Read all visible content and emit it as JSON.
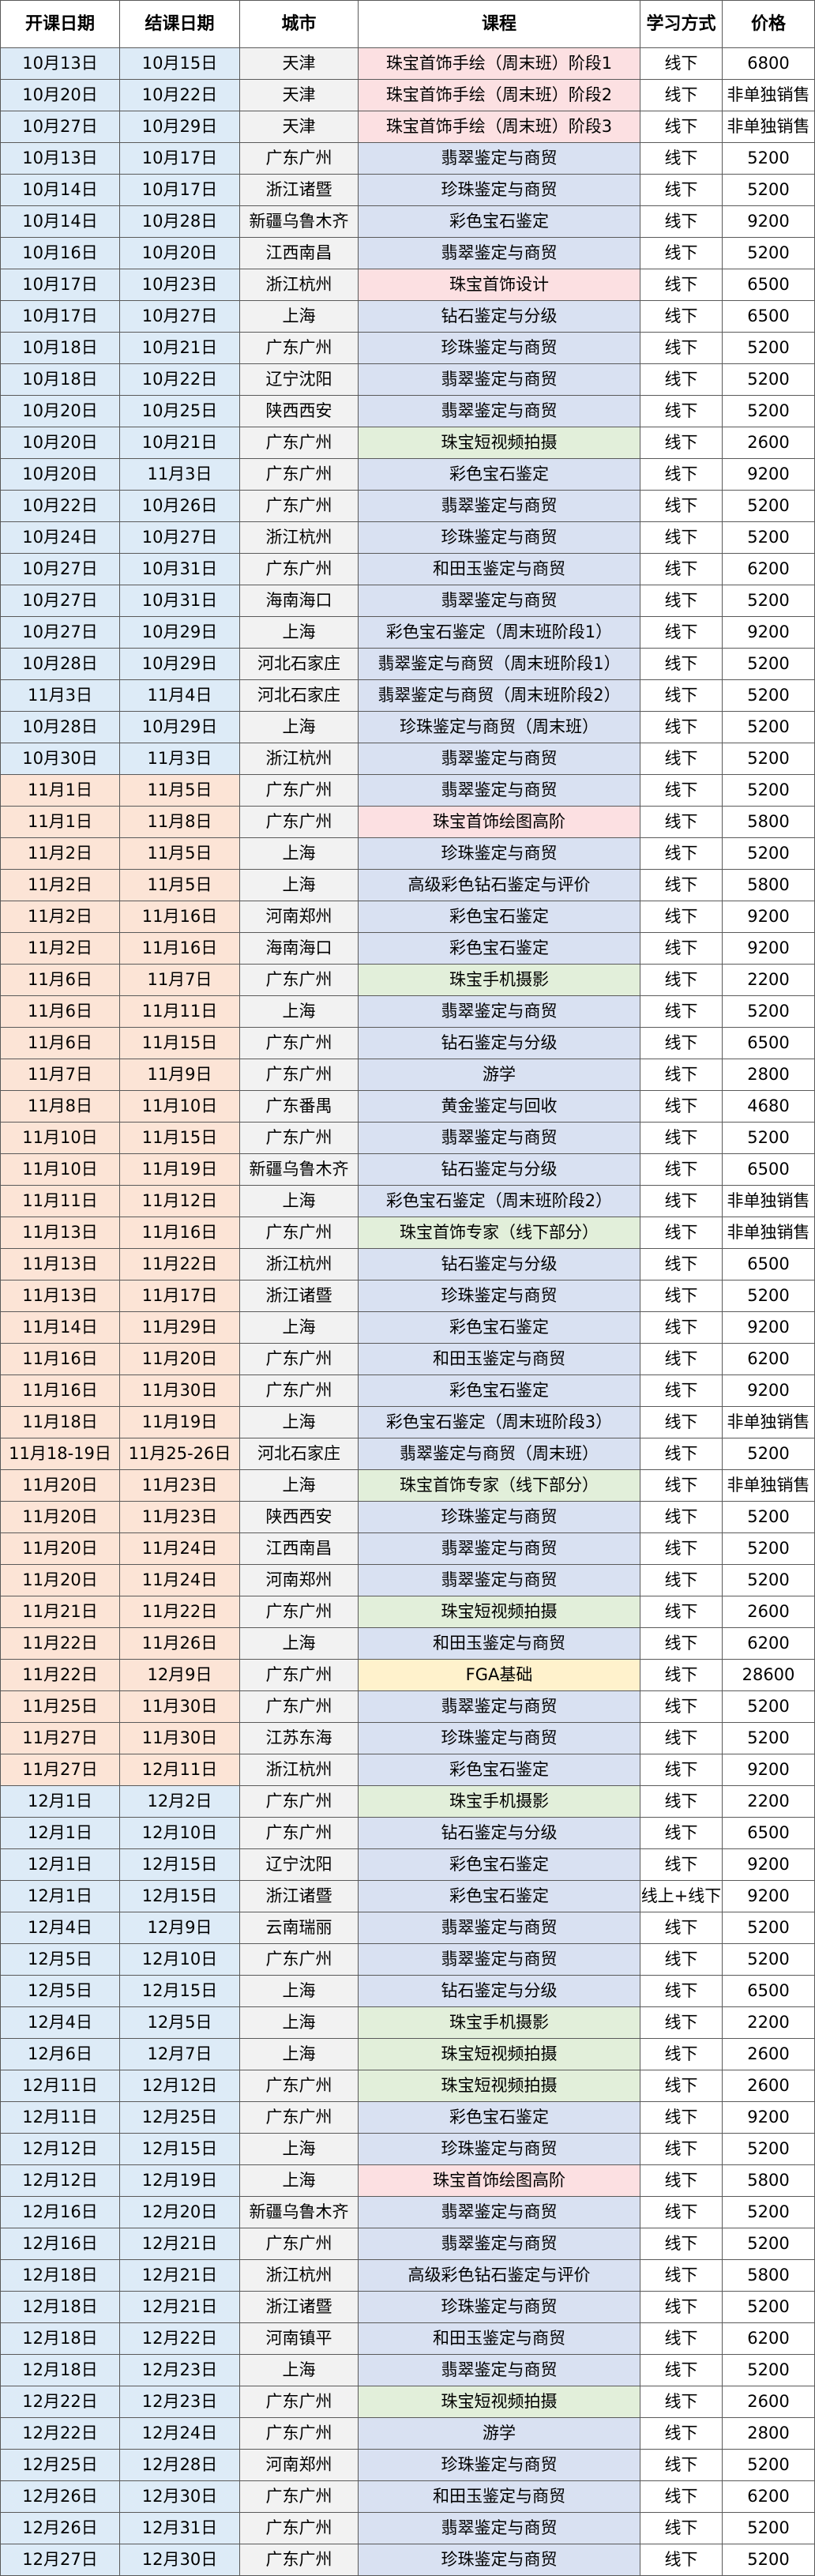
{
  "table": {
    "headers": [
      "开课日期",
      "结课日期",
      "城市",
      "课程",
      "学习方式",
      "价格"
    ],
    "rows": [
      {
        "start": "10月13日",
        "end": "10月15日",
        "city": "天津",
        "course": "珠宝首饰手绘（周末班）阶段1",
        "mode": "线下",
        "price": "6800",
        "date_bg": "#DDEBF7",
        "course_bg": "#FCE0E2"
      },
      {
        "start": "10月20日",
        "end": "10月22日",
        "city": "天津",
        "course": "珠宝首饰手绘（周末班）阶段2",
        "mode": "线下",
        "price": "非单独销售",
        "date_bg": "#DDEBF7",
        "course_bg": "#FCE0E2"
      },
      {
        "start": "10月27日",
        "end": "10月29日",
        "city": "天津",
        "course": "珠宝首饰手绘（周末班）阶段3",
        "mode": "线下",
        "price": "非单独销售",
        "date_bg": "#DDEBF7",
        "course_bg": "#FCE0E2"
      },
      {
        "start": "10月13日",
        "end": "10月17日",
        "city": "广东广州",
        "course": "翡翠鉴定与商贸",
        "mode": "线下",
        "price": "5200",
        "date_bg": "#DDEBF7",
        "course_bg": "#D9E1F2"
      },
      {
        "start": "10月14日",
        "end": "10月17日",
        "city": "浙江诸暨",
        "course": "珍珠鉴定与商贸",
        "mode": "线下",
        "price": "5200",
        "date_bg": "#DDEBF7",
        "course_bg": "#D9E1F2"
      },
      {
        "start": "10月14日",
        "end": "10月28日",
        "city": "新疆乌鲁木齐",
        "course": "彩色宝石鉴定",
        "mode": "线下",
        "price": "9200",
        "date_bg": "#DDEBF7",
        "course_bg": "#D9E1F2"
      },
      {
        "start": "10月16日",
        "end": "10月20日",
        "city": "江西南昌",
        "course": "翡翠鉴定与商贸",
        "mode": "线下",
        "price": "5200",
        "date_bg": "#DDEBF7",
        "course_bg": "#D9E1F2"
      },
      {
        "start": "10月17日",
        "end": "10月23日",
        "city": "浙江杭州",
        "course": "珠宝首饰设计",
        "mode": "线下",
        "price": "6500",
        "date_bg": "#DDEBF7",
        "course_bg": "#FCE0E2"
      },
      {
        "start": "10月17日",
        "end": "10月27日",
        "city": "上海",
        "course": "钻石鉴定与分级",
        "mode": "线下",
        "price": "6500",
        "date_bg": "#DDEBF7",
        "course_bg": "#D9E1F2"
      },
      {
        "start": "10月18日",
        "end": "10月21日",
        "city": "广东广州",
        "course": "珍珠鉴定与商贸",
        "mode": "线下",
        "price": "5200",
        "date_bg": "#DDEBF7",
        "course_bg": "#D9E1F2"
      },
      {
        "start": "10月18日",
        "end": "10月22日",
        "city": "辽宁沈阳",
        "course": "翡翠鉴定与商贸",
        "mode": "线下",
        "price": "5200",
        "date_bg": "#DDEBF7",
        "course_bg": "#D9E1F2"
      },
      {
        "start": "10月20日",
        "end": "10月25日",
        "city": "陕西西安",
        "course": "翡翠鉴定与商贸",
        "mode": "线下",
        "price": "5200",
        "date_bg": "#DDEBF7",
        "course_bg": "#D9E1F2"
      },
      {
        "start": "10月20日",
        "end": "10月21日",
        "city": "广东广州",
        "course": "珠宝短视频拍摄",
        "mode": "线下",
        "price": "2600",
        "date_bg": "#DDEBF7",
        "course_bg": "#E2EFDA"
      },
      {
        "start": "10月20日",
        "end": "11月3日",
        "city": "广东广州",
        "course": "彩色宝石鉴定",
        "mode": "线下",
        "price": "9200",
        "date_bg": "#DDEBF7",
        "course_bg": "#D9E1F2"
      },
      {
        "start": "10月22日",
        "end": "10月26日",
        "city": "广东广州",
        "course": "翡翠鉴定与商贸",
        "mode": "线下",
        "price": "5200",
        "date_bg": "#DDEBF7",
        "course_bg": "#D9E1F2"
      },
      {
        "start": "10月24日",
        "end": "10月27日",
        "city": "浙江杭州",
        "course": "珍珠鉴定与商贸",
        "mode": "线下",
        "price": "5200",
        "date_bg": "#DDEBF7",
        "course_bg": "#D9E1F2"
      },
      {
        "start": "10月27日",
        "end": "10月31日",
        "city": "广东广州",
        "course": "和田玉鉴定与商贸",
        "mode": "线下",
        "price": "6200",
        "date_bg": "#DDEBF7",
        "course_bg": "#D9E1F2"
      },
      {
        "start": "10月27日",
        "end": "10月31日",
        "city": "海南海口",
        "course": "翡翠鉴定与商贸",
        "mode": "线下",
        "price": "5200",
        "date_bg": "#DDEBF7",
        "course_bg": "#D9E1F2"
      },
      {
        "start": "10月27日",
        "end": "10月29日",
        "city": "上海",
        "course": "彩色宝石鉴定（周末班阶段1）",
        "mode": "线下",
        "price": "9200",
        "date_bg": "#DDEBF7",
        "course_bg": "#D9E1F2"
      },
      {
        "start": "10月28日",
        "end": "10月29日",
        "city": "河北石家庄",
        "course": "翡翠鉴定与商贸（周末班阶段1）",
        "mode": "线下",
        "price": "5200",
        "date_bg": "#DDEBF7",
        "course_bg": "#D9E1F2"
      },
      {
        "start": "11月3日",
        "end": "11月4日",
        "city": "河北石家庄",
        "course": "翡翠鉴定与商贸（周末班阶段2）",
        "mode": "线下",
        "price": "5200",
        "date_bg": "#DDEBF7",
        "course_bg": "#D9E1F2"
      },
      {
        "start": "10月28日",
        "end": "10月29日",
        "city": "上海",
        "course": "珍珠鉴定与商贸（周末班）",
        "mode": "线下",
        "price": "5200",
        "date_bg": "#DDEBF7",
        "course_bg": "#D9E1F2"
      },
      {
        "start": "10月30日",
        "end": "11月3日",
        "city": "浙江杭州",
        "course": "翡翠鉴定与商贸",
        "mode": "线下",
        "price": "5200",
        "date_bg": "#DDEBF7",
        "course_bg": "#D9E1F2"
      },
      {
        "start": "11月1日",
        "end": "11月5日",
        "city": "广东广州",
        "course": "翡翠鉴定与商贸",
        "mode": "线下",
        "price": "5200",
        "date_bg": "#FCE4D6",
        "course_bg": "#D9E1F2"
      },
      {
        "start": "11月1日",
        "end": "11月8日",
        "city": "广东广州",
        "course": "珠宝首饰绘图高阶",
        "mode": "线下",
        "price": "5800",
        "date_bg": "#FCE4D6",
        "course_bg": "#FCE0E2"
      },
      {
        "start": "11月2日",
        "end": "11月5日",
        "city": "上海",
        "course": "珍珠鉴定与商贸",
        "mode": "线下",
        "price": "5200",
        "date_bg": "#FCE4D6",
        "course_bg": "#D9E1F2"
      },
      {
        "start": "11月2日",
        "end": "11月5日",
        "city": "上海",
        "course": "高级彩色钻石鉴定与评价",
        "mode": "线下",
        "price": "5800",
        "date_bg": "#FCE4D6",
        "course_bg": "#D9E1F2"
      },
      {
        "start": "11月2日",
        "end": "11月16日",
        "city": "河南郑州",
        "course": "彩色宝石鉴定",
        "mode": "线下",
        "price": "9200",
        "date_bg": "#FCE4D6",
        "course_bg": "#D9E1F2"
      },
      {
        "start": "11月2日",
        "end": "11月16日",
        "city": "海南海口",
        "course": "彩色宝石鉴定",
        "mode": "线下",
        "price": "9200",
        "date_bg": "#FCE4D6",
        "course_bg": "#D9E1F2"
      },
      {
        "start": "11月6日",
        "end": "11月7日",
        "city": "广东广州",
        "course": "珠宝手机摄影",
        "mode": "线下",
        "price": "2200",
        "date_bg": "#FCE4D6",
        "course_bg": "#E2EFDA"
      },
      {
        "start": "11月6日",
        "end": "11月11日",
        "city": "上海",
        "course": "翡翠鉴定与商贸",
        "mode": "线下",
        "price": "5200",
        "date_bg": "#FCE4D6",
        "course_bg": "#D9E1F2"
      },
      {
        "start": "11月6日",
        "end": "11月15日",
        "city": "广东广州",
        "course": "钻石鉴定与分级",
        "mode": "线下",
        "price": "6500",
        "date_bg": "#FCE4D6",
        "course_bg": "#D9E1F2"
      },
      {
        "start": "11月7日",
        "end": "11月9日",
        "city": "广东广州",
        "course": "游学",
        "mode": "线下",
        "price": "2800",
        "date_bg": "#FCE4D6",
        "course_bg": "#D9E1F2"
      },
      {
        "start": "11月8日",
        "end": "11月10日",
        "city": "广东番禺",
        "course": "黄金鉴定与回收",
        "mode": "线下",
        "price": "4680",
        "date_bg": "#FCE4D6",
        "course_bg": "#D9E1F2"
      },
      {
        "start": "11月10日",
        "end": "11月15日",
        "city": "广东广州",
        "course": "翡翠鉴定与商贸",
        "mode": "线下",
        "price": "5200",
        "date_bg": "#FCE4D6",
        "course_bg": "#D9E1F2"
      },
      {
        "start": "11月10日",
        "end": "11月19日",
        "city": "新疆乌鲁木齐",
        "course": "钻石鉴定与分级",
        "mode": "线下",
        "price": "6500",
        "date_bg": "#FCE4D6",
        "course_bg": "#D9E1F2"
      },
      {
        "start": "11月11日",
        "end": "11月12日",
        "city": "上海",
        "course": "彩色宝石鉴定（周末班阶段2）",
        "mode": "线下",
        "price": "非单独销售",
        "date_bg": "#FCE4D6",
        "course_bg": "#D9E1F2"
      },
      {
        "start": "11月13日",
        "end": "11月16日",
        "city": "广东广州",
        "course": "珠宝首饰专家（线下部分）",
        "mode": "线下",
        "price": "非单独销售",
        "date_bg": "#FCE4D6",
        "course_bg": "#E2EFDA"
      },
      {
        "start": "11月13日",
        "end": "11月22日",
        "city": "浙江杭州",
        "course": "钻石鉴定与分级",
        "mode": "线下",
        "price": "6500",
        "date_bg": "#FCE4D6",
        "course_bg": "#D9E1F2"
      },
      {
        "start": "11月13日",
        "end": "11月17日",
        "city": "浙江诸暨",
        "course": "珍珠鉴定与商贸",
        "mode": "线下",
        "price": "5200",
        "date_bg": "#FCE4D6",
        "course_bg": "#D9E1F2"
      },
      {
        "start": "11月14日",
        "end": "11月29日",
        "city": "上海",
        "course": "彩色宝石鉴定",
        "mode": "线下",
        "price": "9200",
        "date_bg": "#FCE4D6",
        "course_bg": "#D9E1F2"
      },
      {
        "start": "11月16日",
        "end": "11月20日",
        "city": "广东广州",
        "course": "和田玉鉴定与商贸",
        "mode": "线下",
        "price": "6200",
        "date_bg": "#FCE4D6",
        "course_bg": "#D9E1F2"
      },
      {
        "start": "11月16日",
        "end": "11月30日",
        "city": "广东广州",
        "course": "彩色宝石鉴定",
        "mode": "线下",
        "price": "9200",
        "date_bg": "#FCE4D6",
        "course_bg": "#D9E1F2"
      },
      {
        "start": "11月18日",
        "end": "11月19日",
        "city": "上海",
        "course": "彩色宝石鉴定（周末班阶段3）",
        "mode": "线下",
        "price": "非单独销售",
        "date_bg": "#FCE4D6",
        "course_bg": "#D9E1F2"
      },
      {
        "start": "11月18-19日",
        "end": "11月25-26日",
        "city": "河北石家庄",
        "course": "翡翠鉴定与商贸（周末班）",
        "mode": "线下",
        "price": "5200",
        "date_bg": "#FCE4D6",
        "course_bg": "#D9E1F2"
      },
      {
        "start": "11月20日",
        "end": "11月23日",
        "city": "上海",
        "course": "珠宝首饰专家（线下部分）",
        "mode": "线下",
        "price": "非单独销售",
        "date_bg": "#FCE4D6",
        "course_bg": "#E2EFDA"
      },
      {
        "start": "11月20日",
        "end": "11月23日",
        "city": "陕西西安",
        "course": "珍珠鉴定与商贸",
        "mode": "线下",
        "price": "5200",
        "date_bg": "#FCE4D6",
        "course_bg": "#D9E1F2"
      },
      {
        "start": "11月20日",
        "end": "11月24日",
        "city": "江西南昌",
        "course": "翡翠鉴定与商贸",
        "mode": "线下",
        "price": "5200",
        "date_bg": "#FCE4D6",
        "course_bg": "#D9E1F2"
      },
      {
        "start": "11月20日",
        "end": "11月24日",
        "city": "河南郑州",
        "course": "翡翠鉴定与商贸",
        "mode": "线下",
        "price": "5200",
        "date_bg": "#FCE4D6",
        "course_bg": "#D9E1F2"
      },
      {
        "start": "11月21日",
        "end": "11月22日",
        "city": "广东广州",
        "course": "珠宝短视频拍摄",
        "mode": "线下",
        "price": "2600",
        "date_bg": "#FCE4D6",
        "course_bg": "#E2EFDA"
      },
      {
        "start": "11月22日",
        "end": "11月26日",
        "city": "上海",
        "course": "和田玉鉴定与商贸",
        "mode": "线下",
        "price": "6200",
        "date_bg": "#FCE4D6",
        "course_bg": "#D9E1F2"
      },
      {
        "start": "11月22日",
        "end": "12月9日",
        "city": "广东广州",
        "course": "FGA基础",
        "mode": "线下",
        "price": "28600",
        "date_bg": "#FCE4D6",
        "course_bg": "#FFF2CC"
      },
      {
        "start": "11月25日",
        "end": "11月30日",
        "city": "广东广州",
        "course": "翡翠鉴定与商贸",
        "mode": "线下",
        "price": "5200",
        "date_bg": "#FCE4D6",
        "course_bg": "#D9E1F2"
      },
      {
        "start": "11月27日",
        "end": "11月30日",
        "city": "江苏东海",
        "course": "珍珠鉴定与商贸",
        "mode": "线下",
        "price": "5200",
        "date_bg": "#FCE4D6",
        "course_bg": "#D9E1F2"
      },
      {
        "start": "11月27日",
        "end": "12月11日",
        "city": "浙江杭州",
        "course": "彩色宝石鉴定",
        "mode": "线下",
        "price": "9200",
        "date_bg": "#FCE4D6",
        "course_bg": "#D9E1F2"
      },
      {
        "start": "12月1日",
        "end": "12月2日",
        "city": "广东广州",
        "course": "珠宝手机摄影",
        "mode": "线下",
        "price": "2200",
        "date_bg": "#DDEBF7",
        "course_bg": "#E2EFDA"
      },
      {
        "start": "12月1日",
        "end": "12月10日",
        "city": "广东广州",
        "course": "钻石鉴定与分级",
        "mode": "线下",
        "price": "6500",
        "date_bg": "#DDEBF7",
        "course_bg": "#D9E1F2"
      },
      {
        "start": "12月1日",
        "end": "12月15日",
        "city": "辽宁沈阳",
        "course": "彩色宝石鉴定",
        "mode": "线下",
        "price": "9200",
        "date_bg": "#DDEBF7",
        "course_bg": "#D9E1F2"
      },
      {
        "start": "12月1日",
        "end": "12月15日",
        "city": "浙江诸暨",
        "course": "彩色宝石鉴定",
        "mode": "线上+线下",
        "price": "9200",
        "date_bg": "#DDEBF7",
        "course_bg": "#D9E1F2"
      },
      {
        "start": "12月4日",
        "end": "12月9日",
        "city": "云南瑞丽",
        "course": "翡翠鉴定与商贸",
        "mode": "线下",
        "price": "5200",
        "date_bg": "#DDEBF7",
        "course_bg": "#D9E1F2"
      },
      {
        "start": "12月5日",
        "end": "12月10日",
        "city": "广东广州",
        "course": "翡翠鉴定与商贸",
        "mode": "线下",
        "price": "5200",
        "date_bg": "#DDEBF7",
        "course_bg": "#D9E1F2"
      },
      {
        "start": "12月5日",
        "end": "12月15日",
        "city": "上海",
        "course": "钻石鉴定与分级",
        "mode": "线下",
        "price": "6500",
        "date_bg": "#DDEBF7",
        "course_bg": "#D9E1F2"
      },
      {
        "start": "12月4日",
        "end": "12月5日",
        "city": "上海",
        "course": "珠宝手机摄影",
        "mode": "线下",
        "price": "2200",
        "date_bg": "#DDEBF7",
        "course_bg": "#E2EFDA"
      },
      {
        "start": "12月6日",
        "end": "12月7日",
        "city": "上海",
        "course": "珠宝短视频拍摄",
        "mode": "线下",
        "price": "2600",
        "date_bg": "#DDEBF7",
        "course_bg": "#E2EFDA"
      },
      {
        "start": "12月11日",
        "end": "12月12日",
        "city": "广东广州",
        "course": "珠宝短视频拍摄",
        "mode": "线下",
        "price": "2600",
        "date_bg": "#DDEBF7",
        "course_bg": "#E2EFDA"
      },
      {
        "start": "12月11日",
        "end": "12月25日",
        "city": "广东广州",
        "course": "彩色宝石鉴定",
        "mode": "线下",
        "price": "9200",
        "date_bg": "#DDEBF7",
        "course_bg": "#D9E1F2"
      },
      {
        "start": "12月12日",
        "end": "12月15日",
        "city": "上海",
        "course": "珍珠鉴定与商贸",
        "mode": "线下",
        "price": "5200",
        "date_bg": "#DDEBF7",
        "course_bg": "#D9E1F2"
      },
      {
        "start": "12月12日",
        "end": "12月19日",
        "city": "上海",
        "course": "珠宝首饰绘图高阶",
        "mode": "线下",
        "price": "5800",
        "date_bg": "#DDEBF7",
        "course_bg": "#FCE0E2"
      },
      {
        "start": "12月16日",
        "end": "12月20日",
        "city": "新疆乌鲁木齐",
        "course": "翡翠鉴定与商贸",
        "mode": "线下",
        "price": "5200",
        "date_bg": "#DDEBF7",
        "course_bg": "#D9E1F2"
      },
      {
        "start": "12月16日",
        "end": "12月21日",
        "city": "广东广州",
        "course": "翡翠鉴定与商贸",
        "mode": "线下",
        "price": "5200",
        "date_bg": "#DDEBF7",
        "course_bg": "#D9E1F2"
      },
      {
        "start": "12月18日",
        "end": "12月21日",
        "city": "浙江杭州",
        "course": "高级彩色钻石鉴定与评价",
        "mode": "线下",
        "price": "5800",
        "date_bg": "#DDEBF7",
        "course_bg": "#D9E1F2"
      },
      {
        "start": "12月18日",
        "end": "12月21日",
        "city": "浙江诸暨",
        "course": "珍珠鉴定与商贸",
        "mode": "线下",
        "price": "5200",
        "date_bg": "#DDEBF7",
        "course_bg": "#D9E1F2"
      },
      {
        "start": "12月18日",
        "end": "12月22日",
        "city": "河南镇平",
        "course": "和田玉鉴定与商贸",
        "mode": "线下",
        "price": "6200",
        "date_bg": "#DDEBF7",
        "course_bg": "#D9E1F2"
      },
      {
        "start": "12月18日",
        "end": "12月23日",
        "city": "上海",
        "course": "翡翠鉴定与商贸",
        "mode": "线下",
        "price": "5200",
        "date_bg": "#DDEBF7",
        "course_bg": "#D9E1F2"
      },
      {
        "start": "12月22日",
        "end": "12月23日",
        "city": "广东广州",
        "course": "珠宝短视频拍摄",
        "mode": "线下",
        "price": "2600",
        "date_bg": "#DDEBF7",
        "course_bg": "#E2EFDA"
      },
      {
        "start": "12月22日",
        "end": "12月24日",
        "city": "广东广州",
        "course": "游学",
        "mode": "线下",
        "price": "2800",
        "date_bg": "#DDEBF7",
        "course_bg": "#D9E1F2"
      },
      {
        "start": "12月25日",
        "end": "12月28日",
        "city": "河南郑州",
        "course": "珍珠鉴定与商贸",
        "mode": "线下",
        "price": "5200",
        "date_bg": "#DDEBF7",
        "course_bg": "#D9E1F2"
      },
      {
        "start": "12月26日",
        "end": "12月30日",
        "city": "广东广州",
        "course": "和田玉鉴定与商贸",
        "mode": "线下",
        "price": "6200",
        "date_bg": "#DDEBF7",
        "course_bg": "#D9E1F2"
      },
      {
        "start": "12月26日",
        "end": "12月31日",
        "city": "广东广州",
        "course": "翡翠鉴定与商贸",
        "mode": "线下",
        "price": "5200",
        "date_bg": "#DDEBF7",
        "course_bg": "#D9E1F2"
      },
      {
        "start": "12月27日",
        "end": "12月30日",
        "city": "广东广州",
        "course": "珍珠鉴定与商贸",
        "mode": "线下",
        "price": "5200",
        "date_bg": "#DDEBF7",
        "course_bg": "#D9E1F2"
      }
    ]
  }
}
